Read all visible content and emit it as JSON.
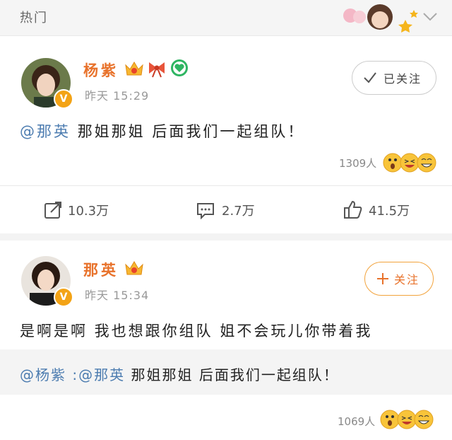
{
  "header": {
    "label": "热门"
  },
  "post": {
    "author": "杨紫",
    "time": "昨天 15:29",
    "follow_label": "已关注",
    "mention": "@那英",
    "text": "那姐那姐 后面我们一起组队！",
    "reaction_count": "1309人",
    "actions": [
      {
        "label": "10.3万",
        "icon": "share-icon"
      },
      {
        "label": "2.7万",
        "icon": "comment-icon"
      },
      {
        "label": "41.5万",
        "icon": "like-icon"
      }
    ]
  },
  "comment": {
    "author": "那英",
    "time": "昨天 15:34",
    "follow_label": "关注",
    "text": "是啊是啊 我也想跟你组队 姐不会玩儿你带着我",
    "quote": {
      "author": "@杨紫",
      "mention": ":@那英",
      "text": "那姐那姐 后面我们一起组队！"
    },
    "reaction_count": "1069人"
  },
  "colors": {
    "username": "#e8722b",
    "mention": "#4c7cb0",
    "badge": "#f3a316"
  }
}
